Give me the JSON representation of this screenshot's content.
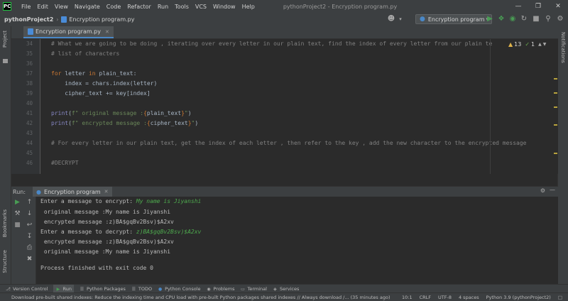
{
  "menu": {
    "logo": "PC",
    "items": [
      "File",
      "Edit",
      "View",
      "Navigate",
      "Code",
      "Refactor",
      "Run",
      "Tools",
      "VCS",
      "Window",
      "Help"
    ],
    "window_title": "pythonProject2 - Encryption program.py"
  },
  "nav": {
    "project": "pythonProject2",
    "file": "Encryption program.py",
    "run_config": "Encryption program"
  },
  "side": {
    "project_label": "Project",
    "bookmarks_label": "Bookmarks",
    "structure_label": "Structure",
    "notifications_label": "Notifications"
  },
  "editor": {
    "tab": "Encryption program.py",
    "warnings": "13",
    "weak_warnings": "1",
    "line_numbers": [
      "34",
      "35",
      "36",
      "37",
      "38",
      "39",
      "40",
      "41",
      "42",
      "43",
      "44",
      "45",
      "46"
    ],
    "lines": [
      "# What we are going to be doing , iterating over every letter in our plain text, find the index of every letter from our plain te",
      "# list of characters",
      "",
      "for letter in plain_text:",
      "    index = chars.index(letter)",
      "    cipher_text += key[index]",
      "",
      "print(f\" original message :{plain_text}\")",
      "print(f\" encrypted message :{cipher_text}\")",
      "",
      "# For every letter in our plain text, get the index of each letter , then refer to the key , add the new character to the encrypted message",
      "",
      "#DECRYPT"
    ]
  },
  "run": {
    "label": "Run:",
    "tab": "Encryption program",
    "console": [
      {
        "text": "Enter a message to encrypt: ",
        "input": "My name is Jiyanshi"
      },
      {
        "text": " original message :My name is Jiyanshi",
        "input": ""
      },
      {
        "text": " encrypted message :z)BA$gqBv2Bsv)$A2xv",
        "input": ""
      },
      {
        "text": "Enter a message to decrypt: ",
        "input": "z)BA$gqBv2Bsv)$A2xv"
      },
      {
        "text": " encrypted message :z)BA$gqBv2Bsv)$A2xv",
        "input": ""
      },
      {
        "text": " original message :My name is Jiyanshi",
        "input": ""
      },
      {
        "text": "",
        "input": ""
      },
      {
        "text": "Process finished with exit code 0",
        "input": ""
      }
    ]
  },
  "tooltabs": [
    "Version Control",
    "Run",
    "Python Packages",
    "TODO",
    "Python Console",
    "Problems",
    "Terminal",
    "Services"
  ],
  "status": {
    "message": "Download pre-built shared indexes: Reduce the indexing time and CPU load with pre-built Python packages shared indexes // Always download /... (35 minutes ago)",
    "position": "10:1",
    "line_sep": "CRLF",
    "encoding": "UTF-8",
    "indent": "4 spaces",
    "interpreter": "Python 3.9 (pythonProject2)"
  },
  "colors": {
    "accent": "#4a88c7",
    "run_green": "#499c54",
    "keyword": "#cc7832",
    "comment": "#808080",
    "string": "#6a8759",
    "input_green": "#4eab4e"
  }
}
